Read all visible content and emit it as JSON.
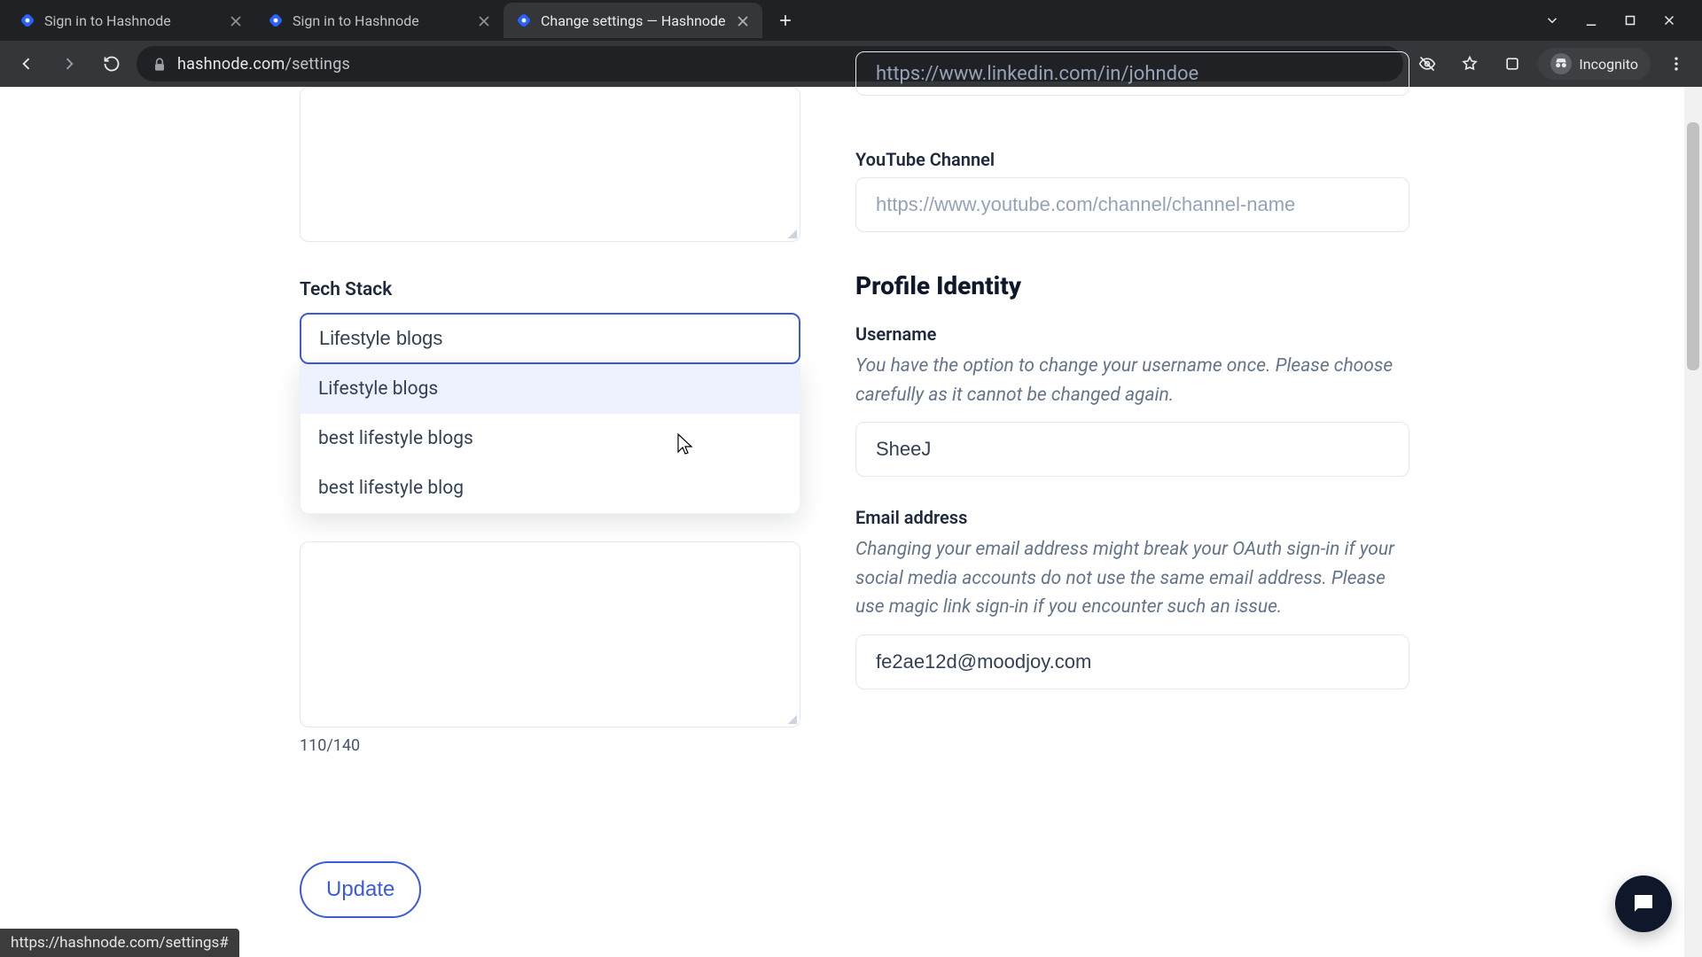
{
  "browser": {
    "tabs": [
      {
        "title": "Sign in to Hashnode",
        "active": false
      },
      {
        "title": "Sign in to Hashnode",
        "active": false
      },
      {
        "title": "Change settings — Hashnode",
        "active": true
      }
    ],
    "url_host": "hashnode.com",
    "url_path": "/settings",
    "incognito_label": "Incognito",
    "status_url": "https://hashnode.com/settings#"
  },
  "left_col": {
    "tech_stack_label": "Tech Stack",
    "tech_stack_value": "Lifestyle blogs",
    "suggestions": [
      "Lifestyle blogs",
      "best lifestyle blogs",
      "best lifestyle blog"
    ],
    "char_count": "110/140",
    "update_label": "Update"
  },
  "right_col": {
    "linkedin_placeholder": "https://www.linkedin.com/in/johndoe",
    "youtube_label": "YouTube Channel",
    "youtube_placeholder": "https://www.youtube.com/channel/channel-name",
    "identity_heading": "Profile Identity",
    "username_label": "Username",
    "username_helper": "You have the option to change your username once. Please choose carefully as it cannot be changed again.",
    "username_value": "SheeJ",
    "email_label": "Email address",
    "email_helper": "Changing your email address might break your OAuth sign-in if your social media accounts do not use the same email address. Please use magic link sign-in if you encounter such an issue.",
    "email_value": "fe2ae12d@moodjoy.com"
  }
}
